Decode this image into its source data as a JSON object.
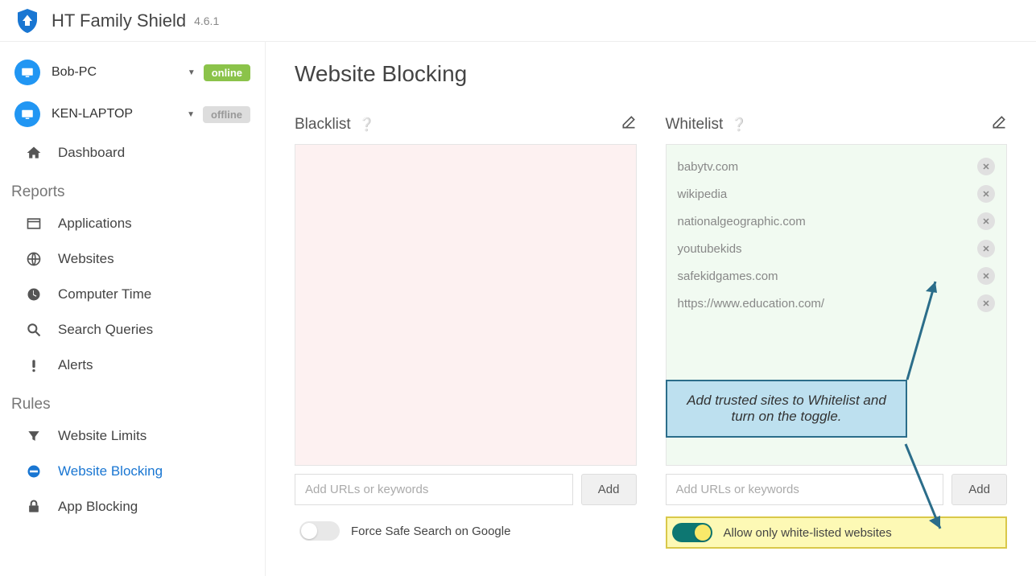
{
  "app": {
    "title": "HT Family Shield",
    "version": "4.6.1"
  },
  "devices": [
    {
      "name": "Bob-PC",
      "status": "online"
    },
    {
      "name": "KEN-LAPTOP",
      "status": "offline"
    }
  ],
  "nav": {
    "dashboard": "Dashboard",
    "reports_label": "Reports",
    "applications": "Applications",
    "websites": "Websites",
    "computer_time": "Computer Time",
    "search_queries": "Search Queries",
    "alerts": "Alerts",
    "rules_label": "Rules",
    "website_limits": "Website Limits",
    "website_blocking": "Website Blocking",
    "app_blocking": "App Blocking"
  },
  "page": {
    "title": "Website Blocking"
  },
  "blacklist": {
    "title": "Blacklist",
    "placeholder": "Add URLs or keywords",
    "add": "Add",
    "items": []
  },
  "whitelist": {
    "title": "Whitelist",
    "placeholder": "Add URLs or keywords",
    "add": "Add",
    "items": [
      "babytv.com",
      "wikipedia",
      "nationalgeographic.com",
      "youtubekids",
      "safekidgames.com",
      "https://www.education.com/"
    ]
  },
  "toggles": {
    "safe_search": "Force Safe Search on Google",
    "whitelist_only": "Allow only white-listed websites"
  },
  "callout": "Add trusted sites to Whitelist and turn on the toggle."
}
